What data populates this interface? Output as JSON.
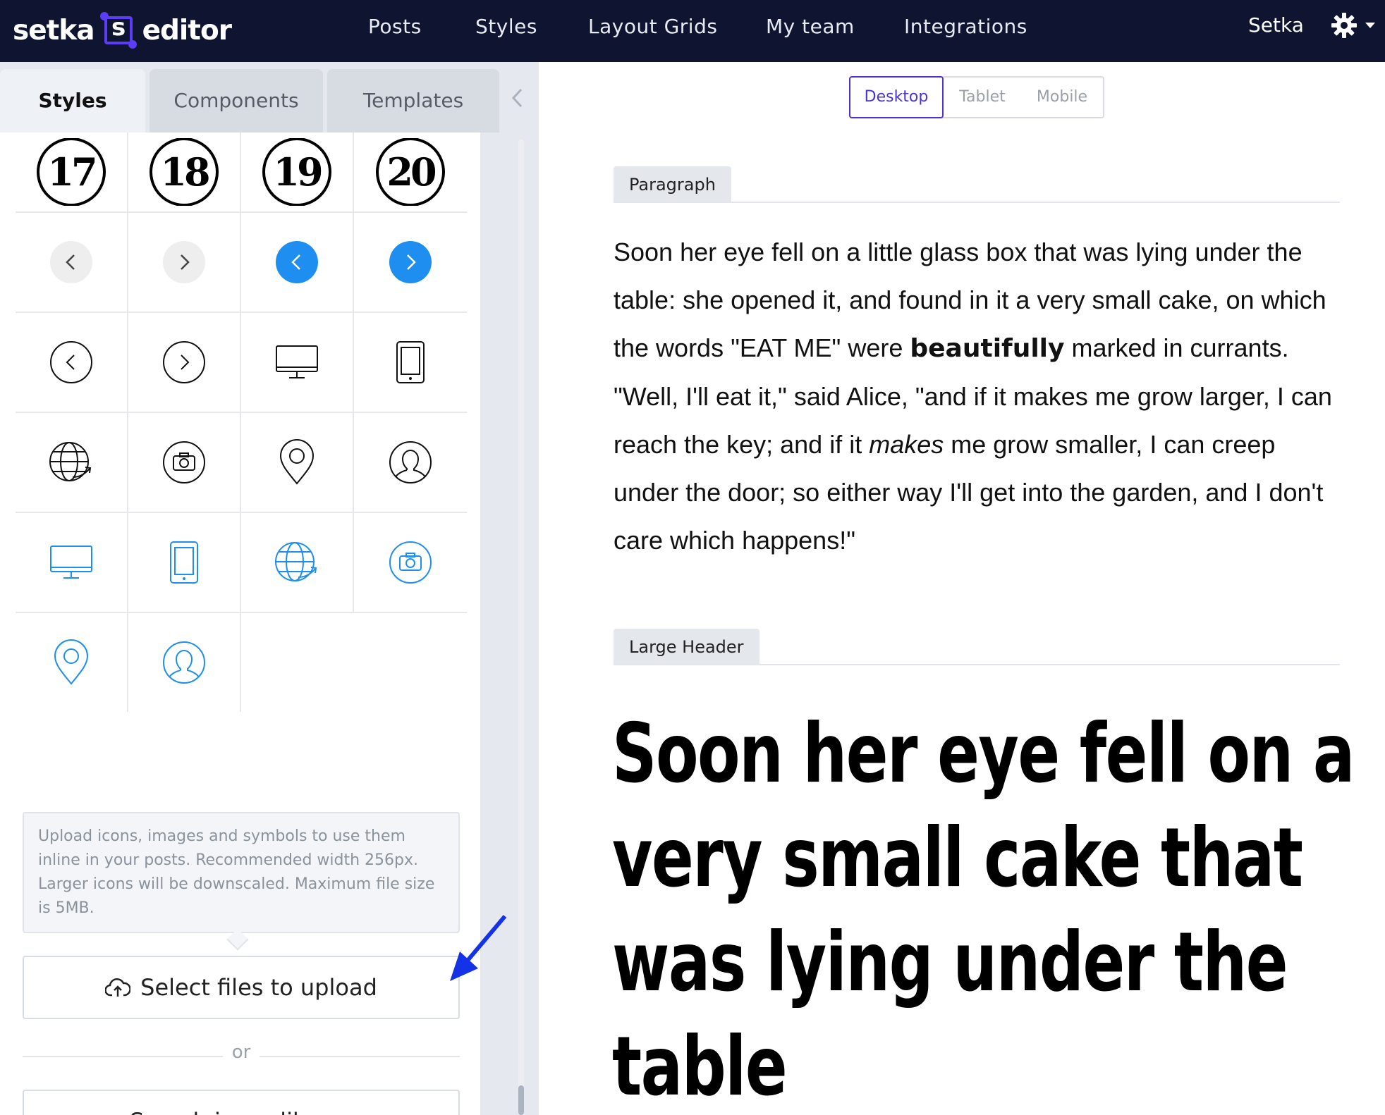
{
  "app": {
    "logo_left": "setka",
    "logo_mark": "s",
    "logo_right": "editor",
    "nav": [
      "Posts",
      "Styles",
      "Layout Grids",
      "My team",
      "Integrations"
    ],
    "user": "Setka",
    "accent_color": "#4a34d6",
    "topbar_color": "#0f1530"
  },
  "sidebar": {
    "tabs": [
      "Styles",
      "Components",
      "Templates"
    ],
    "active_tab": "Styles",
    "icons": {
      "numbers": [
        "17",
        "18",
        "19",
        "20"
      ],
      "items": [
        "arrow-left-gray-icon",
        "arrow-right-gray-icon",
        "arrow-left-blue-icon",
        "arrow-right-blue-icon",
        "circle-arrow-left-icon",
        "circle-arrow-right-icon",
        "desktop-icon",
        "tablet-icon",
        "globe-icon",
        "camera-icon",
        "location-pin-icon",
        "user-avatar-icon",
        "desktop-blue-icon",
        "tablet-blue-icon",
        "globe-blue-icon",
        "camera-blue-icon",
        "location-pin-blue-icon",
        "user-avatar-blue-icon"
      ]
    },
    "upload_hint": "Upload icons, images and symbols to use them inline in your posts. Recommended width 256px. Larger icons will be downscaled. Maximum file size is 5MB.",
    "upload_button": "Select files to upload",
    "or": "or",
    "search_button": "Search icons library"
  },
  "preview": {
    "devices": [
      "Desktop",
      "Tablet",
      "Mobile"
    ],
    "active_device": "Desktop",
    "blocks": [
      {
        "label": "Paragraph",
        "text_parts": [
          "Soon her eye fell on a little glass box that was lying under the table: she opened it, and found in it a very small cake, on which the words \"EAT ME\" were ",
          "beautifully",
          " marked in currants. \"Well, I'll eat it,\" said Alice, \"and if it makes me grow larger, I can reach the key; and if it ",
          "makes",
          " me grow smaller, I can creep under the door; so either way I'll get into the garden, and I don't care which happens!\""
        ]
      },
      {
        "label": "Large Header",
        "text": "Soon her eye fell on a very small cake that was lying under the table"
      }
    ]
  }
}
